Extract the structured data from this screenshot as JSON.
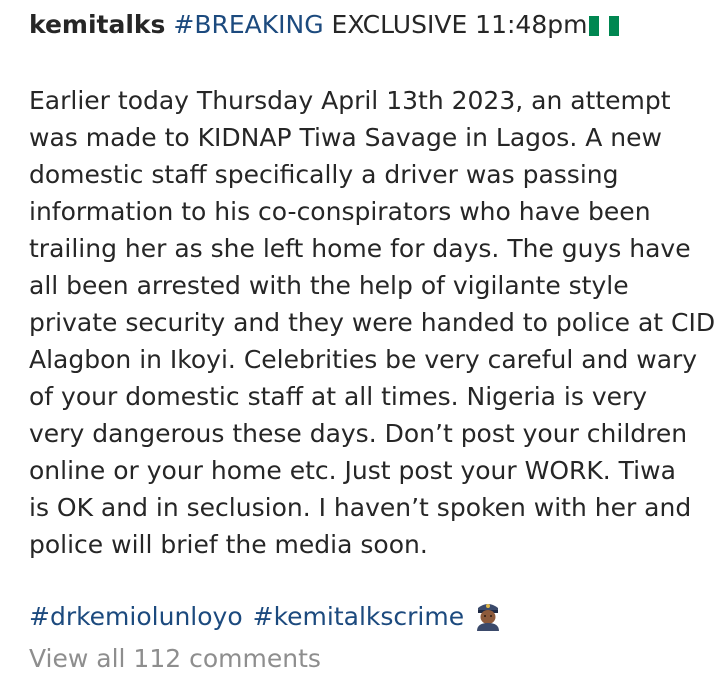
{
  "post": {
    "username": "kemitalks",
    "header_hashtag": "#BREAKING",
    "header_text": " EXCLUSIVE 11:48pm",
    "flag_icon": "nigeria-flag",
    "body_lines": [
      "Earlier today Thursday April 13th 2023, an attempt",
      "was made to KIDNAP Tiwa Savage in Lagos. A new",
      "domestic staff specifically a driver was passing",
      "information to his co-conspirators who have been",
      "trailing her as she left home for days. The guys have",
      "all been arrested with the help of vigilante style",
      "private security and they were handed to police at CID",
      "Alagbon in Ikoyi. Celebrities be very careful and wary",
      "of your domestic staff at all times. Nigeria is very",
      "very dangerous these days. Don’t post your children",
      "online or your home etc. Just post your WORK. Tiwa",
      "is OK and in seclusion. I haven’t spoken with her and",
      "police will brief the media soon."
    ],
    "tags": [
      "#drkemiolunloyo",
      "#kemitalkscrime"
    ],
    "tags_icon": "police-officer-emoji",
    "view_comments": "View all 112 comments"
  },
  "colors": {
    "text": "#262626",
    "hashtag": "#1c4a7e",
    "muted": "#8e8e8e"
  }
}
